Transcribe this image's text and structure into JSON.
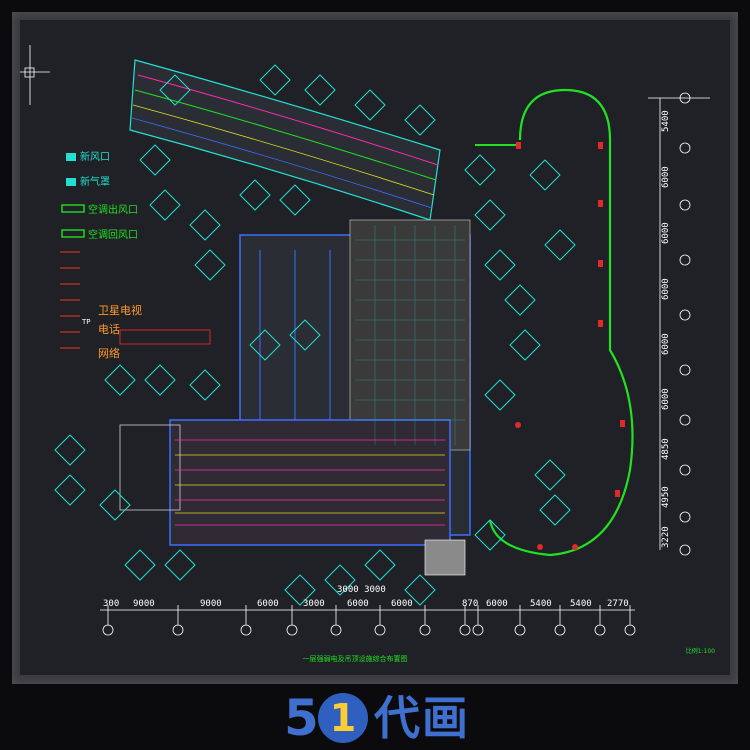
{
  "legend": {
    "items": [
      {
        "label": "新风口",
        "color": "#22e0d0"
      },
      {
        "label": "新气罩",
        "color": "#22e0d0"
      },
      {
        "label": "空调出风口",
        "color": "#22e022"
      },
      {
        "label": "空调回风口",
        "color": "#22e022"
      }
    ],
    "lines": [
      {
        "label": "卫星电视",
        "color": "#ff9a2a"
      },
      {
        "label": "电话",
        "color": "#ff9a2a"
      },
      {
        "label": "TP",
        "color": "#ffffff"
      },
      {
        "label": "网络",
        "color": "#ff9a2a"
      }
    ]
  },
  "dimensions_bottom": [
    "300",
    "9000",
    "9000",
    "6000",
    "3000",
    "6000",
    "6000",
    "870",
    "6000",
    "5400",
    "5400",
    "2770"
  ],
  "dimension_3000_pair": "3000 3000",
  "dimensions_right": [
    "5400",
    "6000",
    "6000",
    "6000",
    "6000",
    "6000",
    "4850",
    "4950",
    "3220"
  ],
  "drawing_title": "一层强弱电及吊顶设施综合布置图",
  "scale_note": "比例1:100",
  "logo": {
    "number": "5",
    "circle": "1",
    "text": "代画"
  }
}
